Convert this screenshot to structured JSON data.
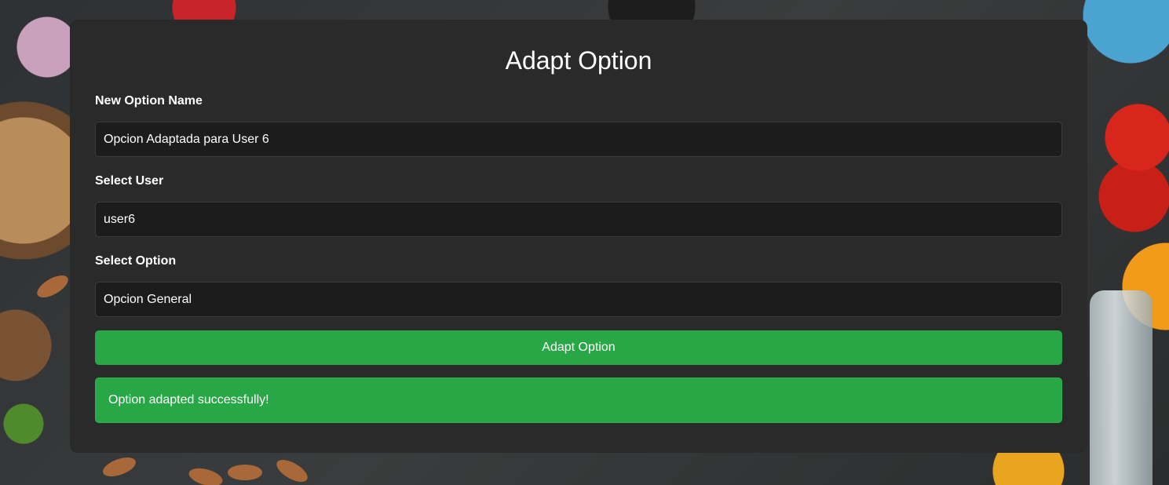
{
  "form": {
    "title": "Adapt Option",
    "option_name": {
      "label": "New Option Name",
      "value": "Opcion Adaptada para User 6"
    },
    "user": {
      "label": "Select User",
      "value": "user6"
    },
    "option": {
      "label": "Select Option",
      "value": "Opcion General"
    },
    "submit_label": "Adapt Option"
  },
  "alert": {
    "message": "Option adapted successfully!"
  },
  "colors": {
    "card_background": "#2a2a2a",
    "input_background": "#1c1c1c",
    "accent_green": "#27a745"
  }
}
